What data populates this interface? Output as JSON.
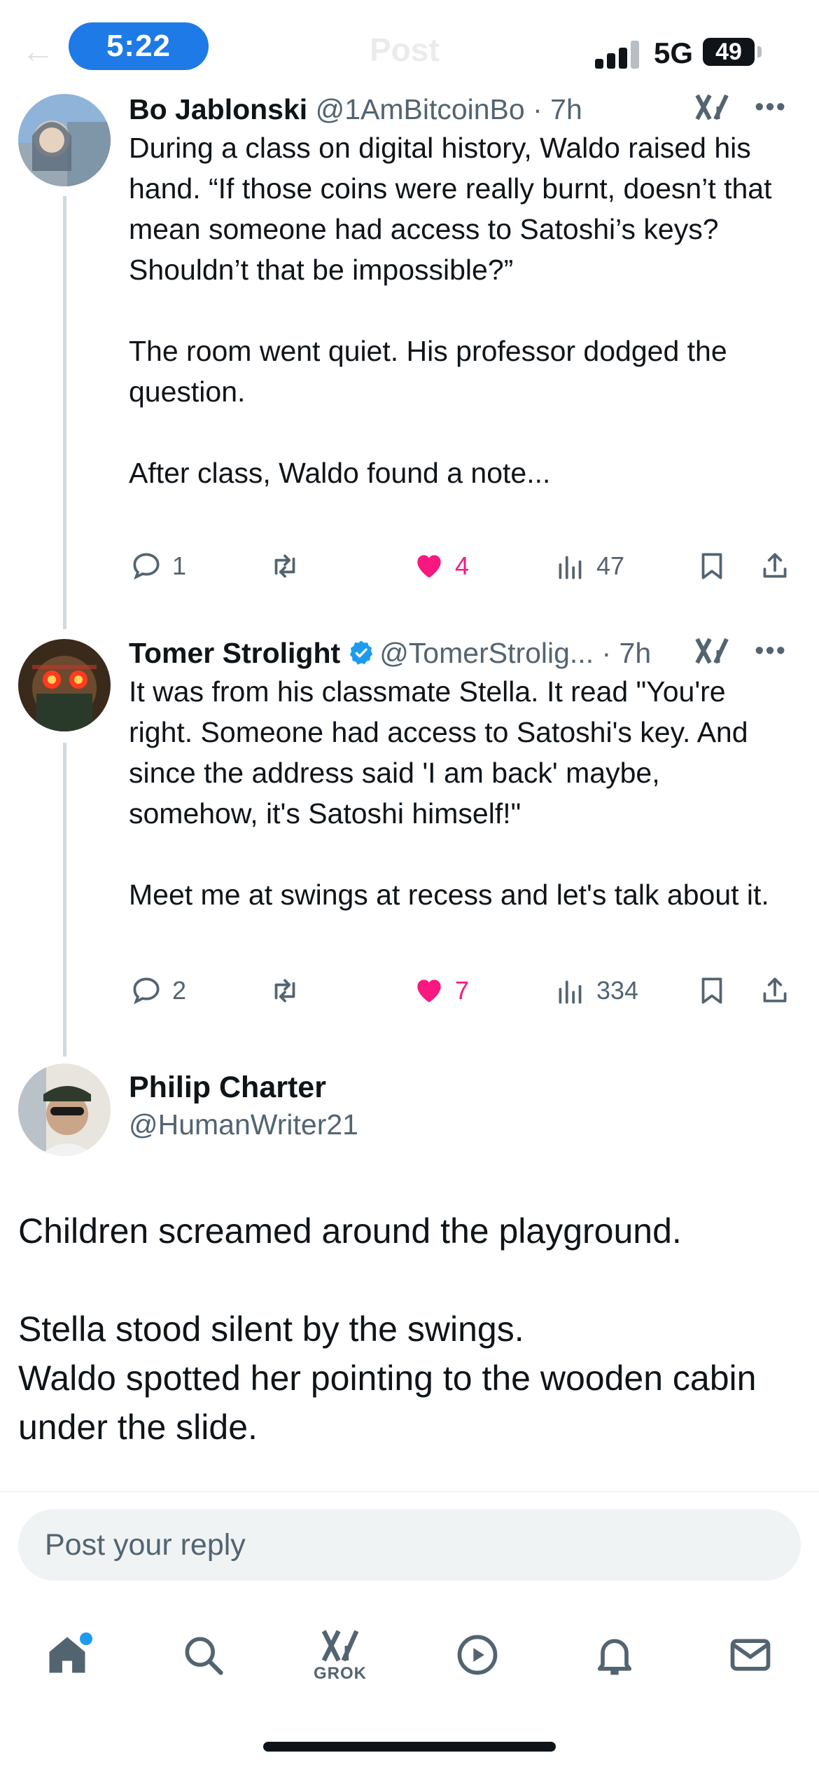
{
  "status_bar": {
    "time": "5:22",
    "network": "5G",
    "battery": "49",
    "back_faded": "←",
    "title_faded": "Post"
  },
  "replies": [
    {
      "name": "Bo Jablonski",
      "handle": "@1AmBitcoinBo · 7h",
      "verified": false,
      "text": "During a class on digital history, Waldo raised his hand. “If those coins were really burnt, doesn’t that mean someone had access to Satoshi’s keys? Shouldn’t that be impossible?”\n\nThe room went quiet. His professor dodged the question.\n\nAfter class, Waldo found a note...",
      "replies_count": "1",
      "likes": "4",
      "views": "47",
      "avatar_colors": [
        "#8fb3d9",
        "#d9c9b5",
        "#5c6b7a"
      ]
    },
    {
      "name": "Tomer Strolight",
      "handle": "@TomerStrolig... · 7h",
      "verified": true,
      "text": "It was from his classmate Stella. It read \"You're right. Someone had access to Satoshi's key. And since the address said 'I am back' maybe, somehow, it's Satoshi himself!\"\n\nMeet me at swings at recess and let's talk about it.",
      "replies_count": "2",
      "likes": "7",
      "views": "334",
      "avatar_colors": [
        "#3a2a1c",
        "#c0392b",
        "#ff3b1f"
      ]
    }
  ],
  "main_post": {
    "name": "Philip Charter",
    "handle": "@HumanWriter21",
    "text": "Children screamed around the playground.\n\nStella stood silent by the swings.\nWaldo spotted her pointing to the wooden cabin under the slide.",
    "avatar_colors": [
      "#e8e4de",
      "#2f3a2c",
      "#caa58a"
    ]
  },
  "reply_box": {
    "placeholder": "Post your reply"
  },
  "tab_bar": {
    "items": [
      "home-icon",
      "search-icon",
      "grok-icon",
      "video-icon",
      "notifications-icon",
      "messages-icon"
    ],
    "grok_label": "GROK"
  },
  "colors": {
    "accent": "#1d9bf0",
    "like": "#f91880",
    "secondary_text": "#536471",
    "time_pill": "#1d7ae6"
  }
}
